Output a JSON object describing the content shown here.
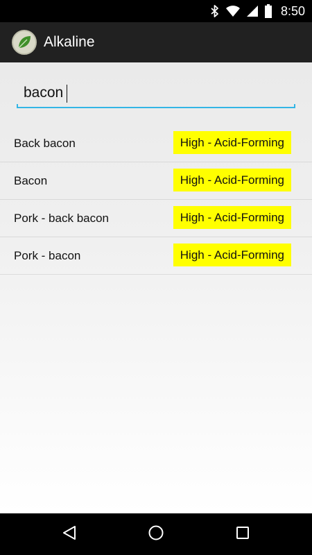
{
  "status_bar": {
    "time": "8:50",
    "icons": [
      "bluetooth-icon",
      "wifi-icon",
      "signal-icon",
      "battery-icon"
    ]
  },
  "app_bar": {
    "title": "Alkaline",
    "logo_icon": "leaf-icon",
    "background": "#212121"
  },
  "search": {
    "value": "bacon",
    "accent_color": "#33b5e5"
  },
  "results": [
    {
      "name": "Back bacon",
      "level": "High - Acid-Forming"
    },
    {
      "name": "Bacon",
      "level": "High - Acid-Forming"
    },
    {
      "name": "Pork - back bacon",
      "level": "High - Acid-Forming"
    },
    {
      "name": "Pork - bacon",
      "level": "High - Acid-Forming"
    }
  ],
  "badge_color": "#ffff00",
  "nav_bar": {
    "buttons": [
      "back-icon",
      "home-icon",
      "recents-icon"
    ]
  }
}
